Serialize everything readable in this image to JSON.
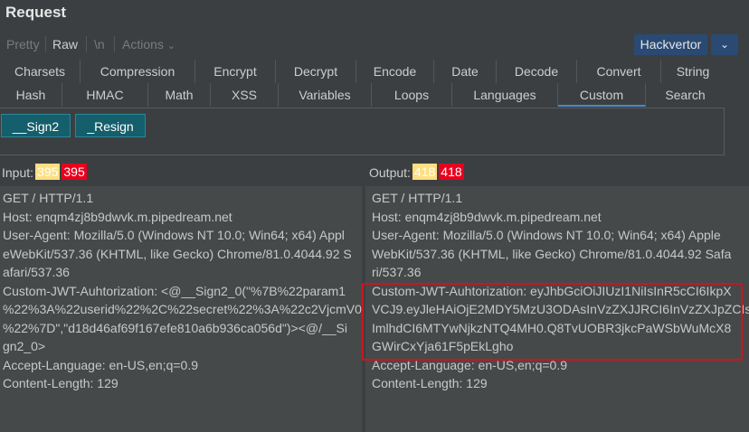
{
  "header": {
    "title": "Request"
  },
  "view_modes": {
    "pretty": "Pretty",
    "raw": "Raw",
    "newline": "\\n",
    "actions": "Actions"
  },
  "hackvertor": {
    "label": "Hackvertor"
  },
  "tabs_row1": [
    "Charsets",
    "Compression",
    "Encrypt",
    "Decrypt",
    "Encode",
    "Date",
    "Decode",
    "Convert",
    "String"
  ],
  "tabs_row2": [
    "Hash",
    "HMAC",
    "Math",
    "XSS",
    "Variables",
    "Loops",
    "Languages",
    "Custom",
    "Search"
  ],
  "active_tab": "Custom",
  "tag_buttons": {
    "sign2": "__Sign2",
    "resign": "_Resign"
  },
  "input": {
    "label": "Input:",
    "count_a": "395",
    "count_b": "395"
  },
  "output": {
    "label": "Output:",
    "count_a": "418",
    "count_b": "418"
  },
  "input_lines": [
    "GET / HTTP/1.1",
    "Host: enqm4zj8b9dwvk.m.pipedream.net",
    "User-Agent: Mozilla/5.0 (Windows NT 10.0; Win64; x64) Appl",
    "eWebKit/537.36 (KHTML, like Gecko) Chrome/81.0.4044.92 S",
    "afari/537.36",
    "Custom-JWT-Auhtorization: <@__Sign2_0(\"%7B%22param1",
    "%22%3A%22userid%22%2C%22secret%22%3A%22c2VjcmV0",
    "%22%7D\",\"d18d46af69f167efe810a6b936ca056d\")><@/__Si",
    "gn2_0>",
    "Accept-Language: en-US,en;q=0.9",
    "Content-Length: 129"
  ],
  "output_lines": [
    "GET / HTTP/1.1",
    "Host: enqm4zj8b9dwvk.m.pipedream.net",
    "User-Agent: Mozilla/5.0 (Windows NT 10.0; Win64; x64) Apple",
    "WebKit/537.36 (KHTML, like Gecko) Chrome/81.0.4044.92 Safa",
    "ri/537.36",
    "Custom-JWT-Auhtorization: eyJhbGciOiJIUzI1NiIsInR5cCI6IkpX",
    "VCJ9.eyJleHAiOjE2MDY5MzU3ODAsInVzZXJJRCI6InVzZXJpZCIs",
    "ImlhdCI6MTYwNjkzNTQ4MH0.Q8TvUOBR3jkcPaWSbWuMcX8",
    "GWirCxYja61F5pEkLgho",
    "Accept-Language: en-US,en;q=0.9",
    "Content-Length: 129"
  ]
}
